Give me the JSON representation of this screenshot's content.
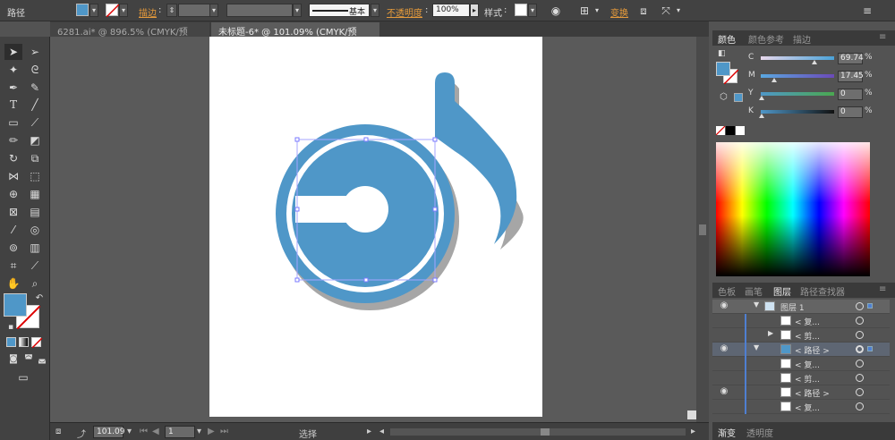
{
  "control_bar": {
    "selection_label": "路径",
    "fill_color": "#4f97c8",
    "stroke_label": "描边",
    "stroke_weight_value": "",
    "brush_value": "",
    "stroke_style_label": "基本",
    "opacity_label": "不透明度",
    "opacity_value": "100%",
    "style_label": "样式",
    "transform_label": "变换"
  },
  "tabs": [
    {
      "label": "6281.ai* @ 896.5% (CMYK/预览)",
      "close": "×"
    },
    {
      "label": "未标题-6* @ 101.09% (CMYK/预览)",
      "close": "×"
    }
  ],
  "status_bar": {
    "zoom": "101.09",
    "artboard_number": "1",
    "tool_name": "选择"
  },
  "color_panel": {
    "tabs": [
      "颜色",
      "颜色参考",
      "描边"
    ],
    "sliders": [
      {
        "label": "C",
        "value": "69.74"
      },
      {
        "label": "M",
        "value": "17.45"
      },
      {
        "label": "Y",
        "value": "0"
      },
      {
        "label": "K",
        "value": "0"
      }
    ],
    "percent": "%",
    "fill_color": "#4f97c8"
  },
  "layers_panel": {
    "tabs": [
      "色板",
      "画笔",
      "图层",
      "路径查找器"
    ],
    "rows": [
      {
        "name": "图层 1"
      },
      {
        "name": "< 复..."
      },
      {
        "name": "< 剪..."
      },
      {
        "name": "< 路径 >"
      },
      {
        "name": "< 复..."
      },
      {
        "name": "< 剪..."
      },
      {
        "name": "< 路径 >"
      },
      {
        "name": "< 复..."
      }
    ]
  },
  "bottom_tabs": [
    "渐变",
    "透明度"
  ],
  "tools": [
    "selection-tool",
    "direct-selection-tool",
    "magic-wand-tool",
    "lasso-tool",
    "pen-tool",
    "curvature-tool",
    "type-tool",
    "line-tool",
    "rectangle-tool",
    "paintbrush-tool",
    "pencil-tool",
    "eraser-tool",
    "rotate-tool",
    "scale-tool",
    "width-tool",
    "free-transform-tool",
    "shape-builder-tool",
    "perspective-tool",
    "mesh-tool",
    "gradient-tool",
    "eyedropper-tool",
    "blend-tool",
    "symbol-sprayer-tool",
    "column-graph-tool",
    "artboard-tool",
    "slice-tool",
    "hand-tool",
    "zoom-tool"
  ],
  "logo_color": "#4f97c8"
}
